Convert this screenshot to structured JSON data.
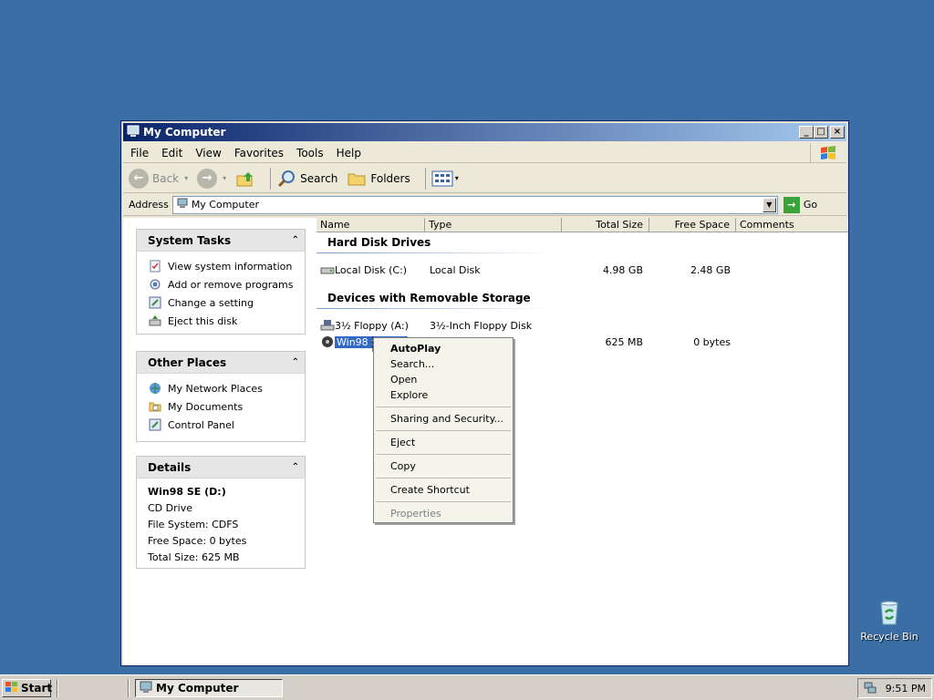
{
  "desktop": {
    "recycle_bin_label": "Recycle Bin"
  },
  "window": {
    "title": "My Computer",
    "menu": [
      "File",
      "Edit",
      "View",
      "Favorites",
      "Tools",
      "Help"
    ],
    "toolbar": {
      "back": "Back",
      "search": "Search",
      "folders": "Folders"
    },
    "address": {
      "label": "Address",
      "value": "My Computer",
      "go": "Go"
    }
  },
  "left_pane": {
    "system_tasks": {
      "title": "System Tasks",
      "items": [
        "View system information",
        "Add or remove programs",
        "Change a setting",
        "Eject this disk"
      ]
    },
    "other_places": {
      "title": "Other Places",
      "items": [
        "My Network Places",
        "My Documents",
        "Control Panel"
      ]
    },
    "details": {
      "title": "Details",
      "name": "Win98 SE (D:)",
      "type": "CD Drive",
      "file_system": "File System: CDFS",
      "free_space": "Free Space: 0 bytes",
      "total_size": "Total Size: 625 MB"
    }
  },
  "list": {
    "columns": [
      "Name",
      "Type",
      "Total Size",
      "Free Space",
      "Comments"
    ],
    "groups": {
      "hdd": "Hard Disk Drives",
      "removable": "Devices with Removable Storage"
    },
    "items": [
      {
        "name": "Local Disk (C:)",
        "type": "Local Disk",
        "total": "4.98 GB",
        "free": "2.48 GB"
      },
      {
        "name": "3½ Floppy (A:)",
        "type": "3½-Inch Floppy Disk",
        "total": "",
        "free": ""
      },
      {
        "name": "Win98 SE (D:)",
        "type": "CD Drive",
        "total": "625 MB",
        "free": "0 bytes"
      }
    ]
  },
  "context_menu": {
    "items": [
      "AutoPlay",
      "Search...",
      "Open",
      "Explore",
      "Sharing and Security...",
      "Eject",
      "Copy",
      "Create Shortcut",
      "Properties"
    ]
  },
  "taskbar": {
    "start": "Start",
    "task": "My Computer",
    "clock": "9:51 PM"
  },
  "colors": {
    "desktop": "#3a6ea5",
    "selection": "#316ac5",
    "title_start": "#0a246a"
  }
}
